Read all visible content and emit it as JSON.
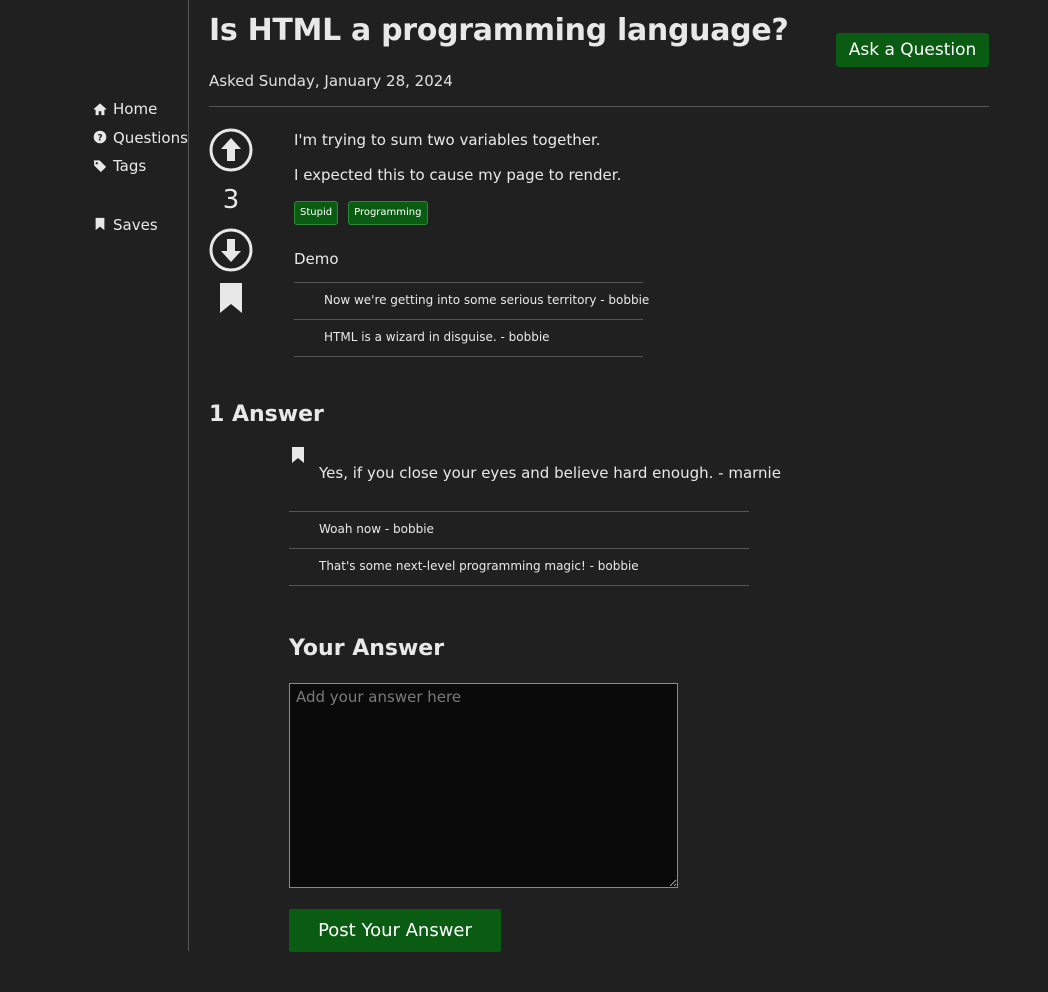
{
  "sidebar": {
    "items": [
      {
        "label": "Home",
        "icon": "home-icon"
      },
      {
        "label": "Questions",
        "icon": "question-circle-icon"
      },
      {
        "label": "Tags",
        "icon": "tag-icon"
      },
      {
        "label": "Saves",
        "icon": "bookmark-icon"
      }
    ]
  },
  "header": {
    "title": "Is HTML a programming language?",
    "ask_button": "Ask a Question",
    "asked": "Asked Sunday, January 28, 2024"
  },
  "question": {
    "votes": "3",
    "paragraphs": [
      "I'm trying to sum two variables together.",
      "I expected this to cause my page to render."
    ],
    "tags": [
      "Stupid",
      "Programming"
    ],
    "author": "Demo",
    "comments": [
      "Now we're getting into some serious territory - bobbie",
      "HTML is a wizard in disguise. - bobbie"
    ]
  },
  "answers": {
    "heading": "1 Answer",
    "items": [
      {
        "text": "Yes, if you close your eyes and believe hard enough. - marnie",
        "comments": [
          "Woah now - bobbie",
          "That's some next-level programming magic! - bobbie"
        ]
      }
    ]
  },
  "your_answer": {
    "heading": "Your Answer",
    "placeholder": "Add your answer here",
    "value": "",
    "post_button": "Post Your Answer"
  },
  "colors": {
    "background": "#202020",
    "accent_green": "#0a5c12",
    "text": "#e8e8e8",
    "divider": "#555555",
    "input_bg": "#0a0a0a"
  }
}
